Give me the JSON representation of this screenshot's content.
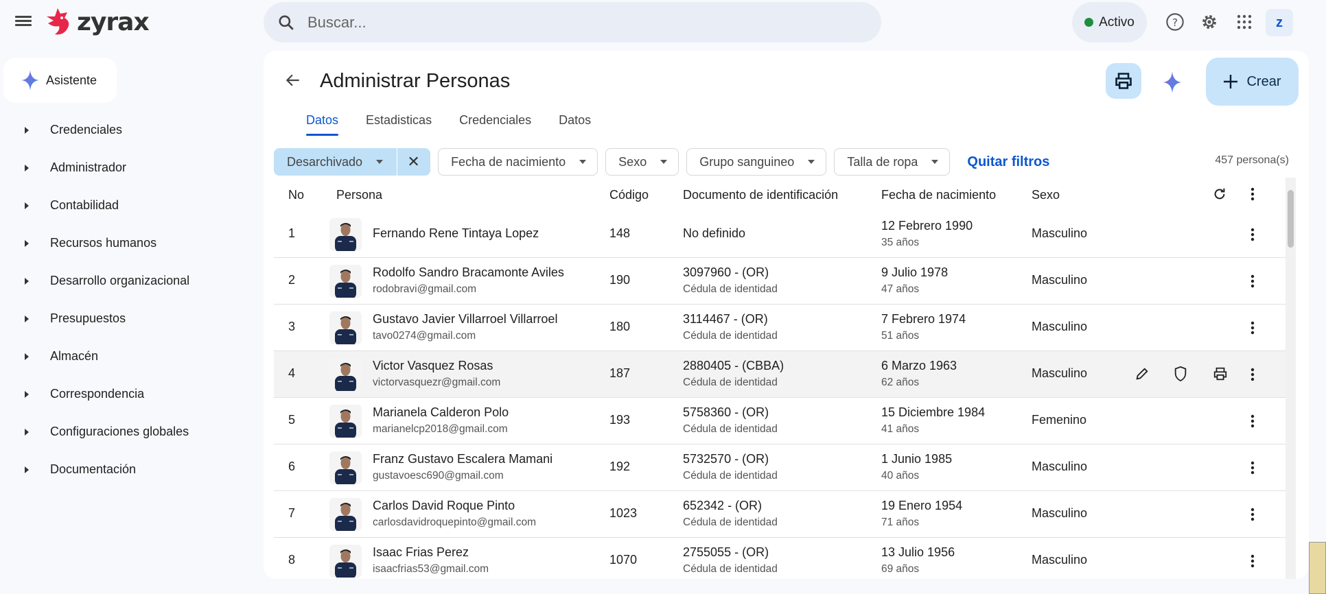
{
  "header": {
    "logo_text": "zyrax",
    "search_placeholder": "Buscar...",
    "status": "Activo",
    "avatar_letter": "z"
  },
  "sidebar": {
    "assistant_label": "Asistente",
    "items": [
      {
        "label": "Credenciales"
      },
      {
        "label": "Administrador"
      },
      {
        "label": "Contabilidad"
      },
      {
        "label": "Recursos humanos"
      },
      {
        "label": "Desarrollo organizacional"
      },
      {
        "label": "Presupuestos"
      },
      {
        "label": "Almacén"
      },
      {
        "label": "Correspondencia"
      },
      {
        "label": "Configuraciones globales"
      },
      {
        "label": "Documentación"
      }
    ]
  },
  "page": {
    "title": "Administrar Personas",
    "create_label": "Crear",
    "tabs": [
      {
        "label": "Datos"
      },
      {
        "label": "Estadisticas"
      },
      {
        "label": "Credenciales"
      },
      {
        "label": "Datos"
      }
    ],
    "filters": {
      "archive": "Desarchivado",
      "birth": "Fecha de nacimiento",
      "sex": "Sexo",
      "blood": "Grupo sanguineo",
      "size": "Talla de ropa",
      "clear": "Quitar filtros"
    },
    "count": "457 persona(s)"
  },
  "table": {
    "columns": {
      "no": "No",
      "person": "Persona",
      "code": "Código",
      "doc": "Documento de identificación",
      "birth": "Fecha de nacimiento",
      "sex": "Sexo"
    },
    "rows": [
      {
        "no": "1",
        "name": "Fernando Rene Tintaya Lopez",
        "email": "",
        "code": "148",
        "doc": "No definido",
        "doc_type": "",
        "birth": "12 Febrero 1990",
        "age": "35 años",
        "sex": "Masculino"
      },
      {
        "no": "2",
        "name": "Rodolfo Sandro Bracamonte Aviles",
        "email": "rodobravi@gmail.com",
        "code": "190",
        "doc": "3097960 - (OR)",
        "doc_type": "Cédula de identidad",
        "birth": "9 Julio 1978",
        "age": "47 años",
        "sex": "Masculino"
      },
      {
        "no": "3",
        "name": "Gustavo Javier Villarroel Villarroel",
        "email": "tavo0274@gmail.com",
        "code": "180",
        "doc": "3114467 - (OR)",
        "doc_type": "Cédula de identidad",
        "birth": "7 Febrero 1974",
        "age": "51 años",
        "sex": "Masculino"
      },
      {
        "no": "4",
        "name": "Victor Vasquez Rosas",
        "email": "victorvasquezr@gmail.com",
        "code": "187",
        "doc": "2880405 - (CBBA)",
        "doc_type": "Cédula de identidad",
        "birth": "6 Marzo 1963",
        "age": "62 años",
        "sex": "Masculino"
      },
      {
        "no": "5",
        "name": "Marianela Calderon Polo",
        "email": "marianelcp2018@gmail.com",
        "code": "193",
        "doc": "5758360 - (OR)",
        "doc_type": "Cédula de identidad",
        "birth": "15 Diciembre 1984",
        "age": "41 años",
        "sex": "Femenino"
      },
      {
        "no": "6",
        "name": "Franz Gustavo Escalera Mamani",
        "email": "gustavoesc690@gmail.com",
        "code": "192",
        "doc": "5732570 - (OR)",
        "doc_type": "Cédula de identidad",
        "birth": "1 Junio 1985",
        "age": "40 años",
        "sex": "Masculino"
      },
      {
        "no": "7",
        "name": "Carlos David Roque Pinto",
        "email": "carlosdavidroquepinto@gmail.com",
        "code": "1023",
        "doc": "652342 - (OR)",
        "doc_type": "Cédula de identidad",
        "birth": "19 Enero 1954",
        "age": "71 años",
        "sex": "Masculino"
      },
      {
        "no": "8",
        "name": "Isaac Frias Perez",
        "email": "isaacfrias53@gmail.com",
        "code": "1070",
        "doc": "2755055 - (OR)",
        "doc_type": "Cédula de identidad",
        "birth": "13 Julio 1956",
        "age": "69 años",
        "sex": "Masculino"
      }
    ]
  },
  "colors": {
    "accent": "#0b57d0",
    "chip": "#bfe0f7",
    "button": "#c7e4fb",
    "status": "#1e8e3e",
    "logo": "#e8264a"
  }
}
